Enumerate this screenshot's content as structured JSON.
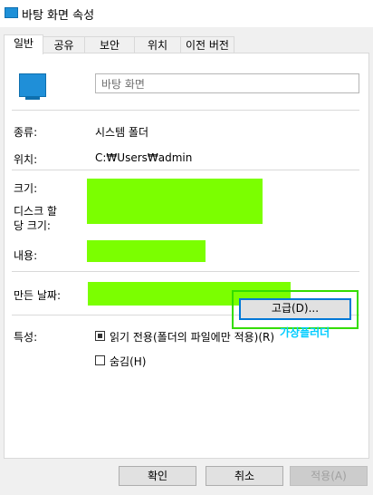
{
  "window": {
    "title": "바탕 화면 속성"
  },
  "tabs": [
    {
      "label": "일반",
      "active": true
    },
    {
      "label": "공유",
      "active": false
    },
    {
      "label": "보안",
      "active": false
    },
    {
      "label": "위치",
      "active": false
    },
    {
      "label": "이전 버전",
      "active": false
    }
  ],
  "general": {
    "name_value": "바탕 화면",
    "type_label": "종류:",
    "type_value": "시스템 폴더",
    "location_label": "위치:",
    "location_value": "C:₩Users₩admin",
    "size_label": "크기:",
    "size_on_disk_label": "디스크 할\n당 크기:",
    "contains_label": "내용:",
    "created_label": "만든 날짜:",
    "attributes_label": "특성:",
    "readonly_label": "읽기 전용(폴더의 파일에만 적용)(R)",
    "hidden_label": "숨김(H)",
    "advanced_button": "고급(D)...",
    "annotation": "가상플러더"
  },
  "buttons": {
    "ok": "확인",
    "cancel": "취소",
    "apply": "적용(A)"
  },
  "colors": {
    "redaction": "#7bff00",
    "highlight_border": "#33dd00",
    "annotation_text": "#00ccff",
    "focus_border": "#0078d7"
  }
}
